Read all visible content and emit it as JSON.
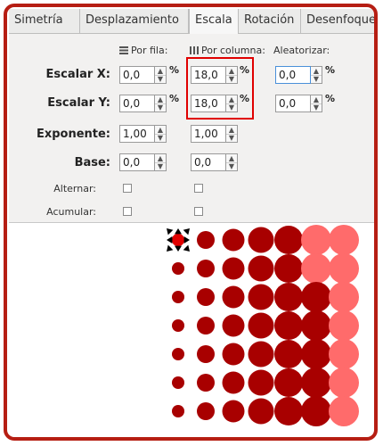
{
  "tabs": [
    {
      "label": "Simetría"
    },
    {
      "label": "Desplazamiento"
    },
    {
      "label": "Escala"
    },
    {
      "label": "Rotación"
    },
    {
      "label": "Desenfoque y c"
    }
  ],
  "active_tab": "Escala",
  "columns": {
    "per_row": "Por fila:",
    "per_column": "Por columna:",
    "random": "Aleatorizar:"
  },
  "rows": {
    "scale_x": {
      "label": "Escalar X:",
      "per_row": "0,0",
      "per_column": "18,0",
      "random": "0,0",
      "unit": "%"
    },
    "scale_y": {
      "label": "Escalar Y:",
      "per_row": "0,0",
      "per_column": "18,0",
      "random": "0,0",
      "unit": "%"
    },
    "exponent": {
      "label": "Exponente:",
      "per_row": "1,00",
      "per_column": "1,00"
    },
    "base": {
      "label": "Base:",
      "per_row": "0,0",
      "per_column": "0,0"
    },
    "alternate": {
      "label": "Alternar:"
    },
    "cumulate": {
      "label": "Acumular:"
    }
  },
  "colors": {
    "frame": "#b61e13",
    "highlight": "#e00000",
    "dot_dark": "#a80000",
    "dot_mid": "#c81010",
    "dot_light": "#ff6b6b"
  }
}
